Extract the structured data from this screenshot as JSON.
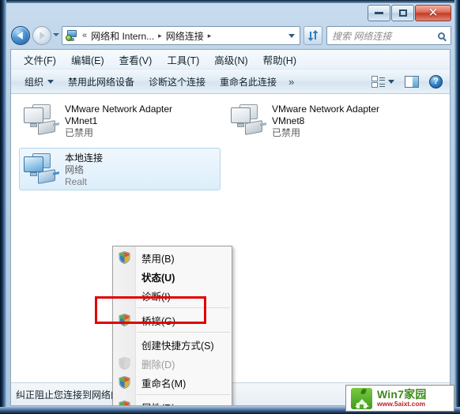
{
  "window": {
    "buttons": {
      "minimize": "—",
      "maximize": "□",
      "close": "✕"
    }
  },
  "nav": {
    "back_tooltip": "后退",
    "forward_tooltip": "前进",
    "breadcrumb": {
      "items": [
        "网络和 Intern...",
        "网络连接"
      ],
      "overflow": "«",
      "separator": "▸"
    },
    "refresh": "↻",
    "search": {
      "placeholder": "搜索 网络连接",
      "value": ""
    }
  },
  "menubar": {
    "items": [
      "文件(F)",
      "编辑(E)",
      "查看(V)",
      "工具(T)",
      "高级(N)",
      "帮助(H)"
    ]
  },
  "toolbar": {
    "organize": "组织",
    "items": [
      "禁用此网络设备",
      "诊断这个连接",
      "重命名此连接"
    ],
    "overflow": "»",
    "help_glyph": "?"
  },
  "adapters": [
    {
      "name": "VMware Network Adapter",
      "name2": "VMnet1",
      "status": "已禁用",
      "enabled": false
    },
    {
      "name": "VMware Network Adapter",
      "name2": "VMnet8",
      "status": "已禁用",
      "enabled": false
    },
    {
      "name": "本地连接",
      "name2": "网络",
      "status": "Realt",
      "enabled": true,
      "selected": true
    }
  ],
  "context_menu": {
    "items": [
      {
        "label": "禁用(B)",
        "shield": true,
        "bold": false,
        "disabled": false
      },
      {
        "label": "状态(U)",
        "shield": false,
        "bold": true,
        "disabled": false
      },
      {
        "label": "诊断(I)",
        "shield": false,
        "bold": false,
        "disabled": false
      },
      {
        "label": "桥接(G)",
        "shield": true,
        "bold": false,
        "disabled": false
      },
      {
        "label": "创建快捷方式(S)",
        "shield": false,
        "bold": false,
        "disabled": false
      },
      {
        "label": "删除(D)",
        "shield": true,
        "bold": false,
        "disabled": true
      },
      {
        "label": "重命名(M)",
        "shield": true,
        "bold": false,
        "disabled": false
      },
      {
        "label": "属性(R)",
        "shield": true,
        "bold": false,
        "disabled": false
      }
    ],
    "highlight_color": "#e00000",
    "highlighted_item": "属性(R)"
  },
  "statusbar": {
    "text": "纠正阻止您连接到网络的问题。"
  },
  "watermark": {
    "title": "Win7家园",
    "url": "www.5aixt.com"
  }
}
